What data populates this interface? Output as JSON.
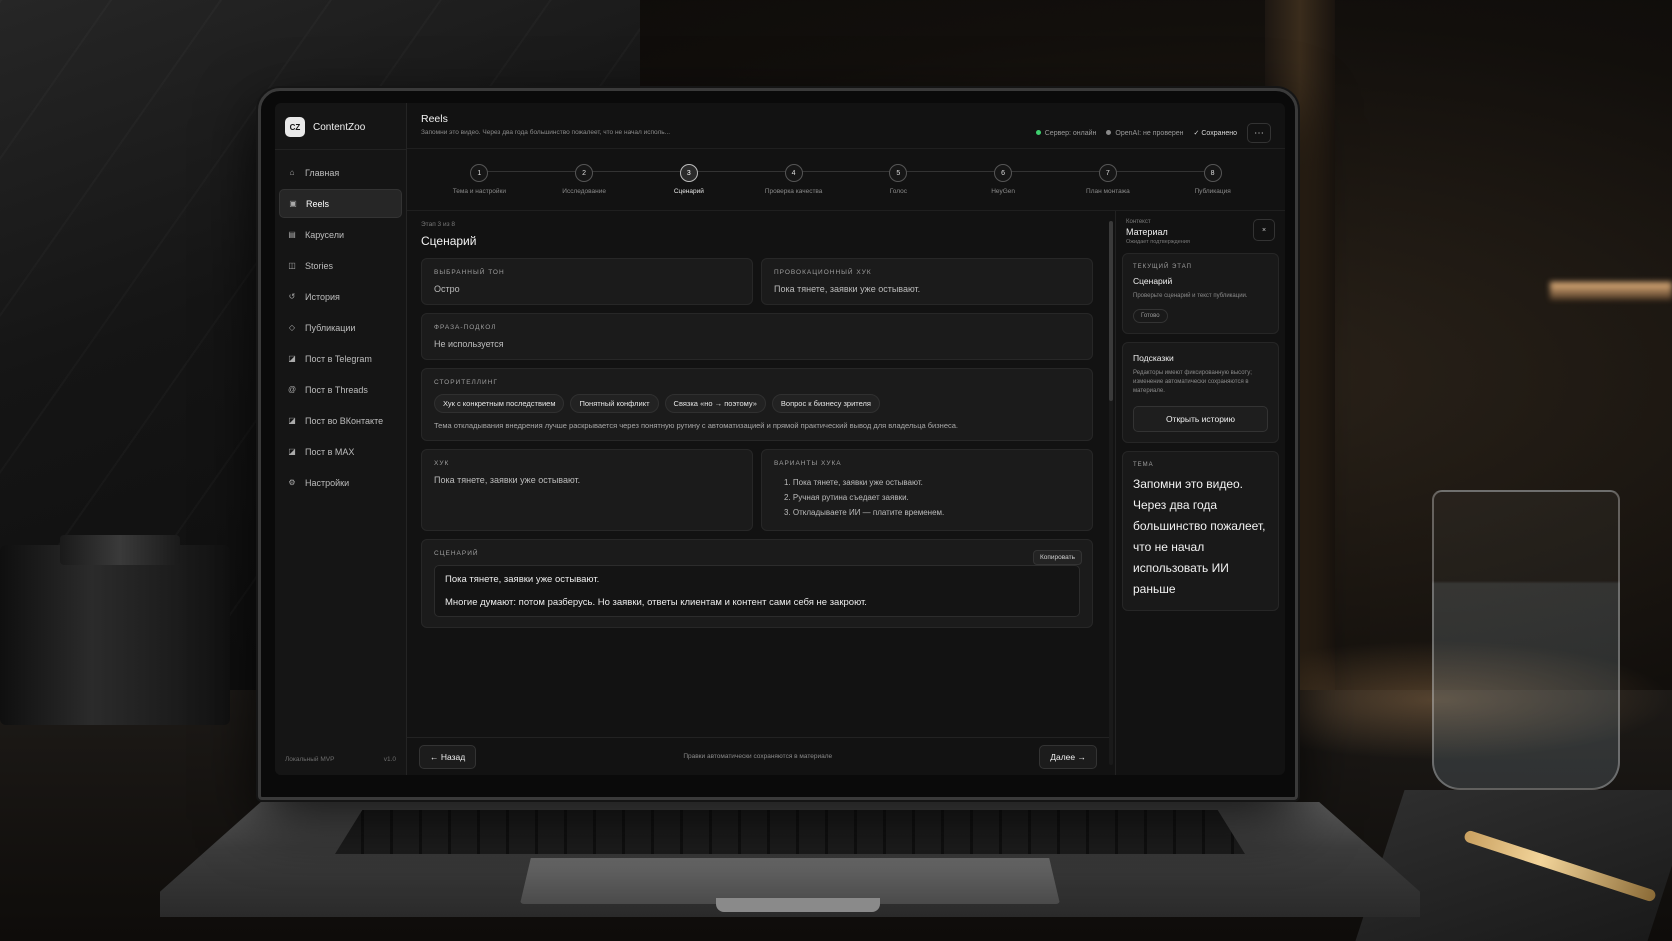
{
  "app": {
    "logo": "CZ",
    "name": "ContentZoo"
  },
  "sidebar": {
    "items": [
      {
        "icon": "home-icon",
        "label": "Главная",
        "active": false
      },
      {
        "icon": "reels-icon",
        "label": "Reels",
        "active": true
      },
      {
        "icon": "carousel-icon",
        "label": "Карусели",
        "active": false
      },
      {
        "icon": "stories-icon",
        "label": "Stories",
        "active": false
      },
      {
        "icon": "history-icon",
        "label": "История",
        "active": false
      },
      {
        "icon": "publish-icon",
        "label": "Публикации",
        "active": false
      },
      {
        "icon": "telegram-icon",
        "label": "Пост в Telegram",
        "active": false
      },
      {
        "icon": "threads-icon",
        "label": "Пост в Threads",
        "active": false
      },
      {
        "icon": "vk-icon",
        "label": "Пост во ВКонтакте",
        "active": false
      },
      {
        "icon": "max-icon",
        "label": "Пост в MAX",
        "active": false
      },
      {
        "icon": "settings-icon",
        "label": "Настройки",
        "active": false
      }
    ],
    "footer_left": "Локальный MVP",
    "footer_right": "v1.0"
  },
  "topbar": {
    "title": "Reels",
    "subtitle": "Запомни это видео. Через два года большинство пожалеет, что не начал исполь...",
    "server_status": "Сервер: онлайн",
    "openai_status": "OpenAI: не проверен",
    "saved_status": "✓ Сохранено",
    "more": "⋯"
  },
  "stepper": {
    "current": 3,
    "steps": [
      {
        "num": "1",
        "label": "Тема и настройки"
      },
      {
        "num": "2",
        "label": "Исследование"
      },
      {
        "num": "3",
        "label": "Сценарий"
      },
      {
        "num": "4",
        "label": "Проверка качества"
      },
      {
        "num": "5",
        "label": "Голос"
      },
      {
        "num": "6",
        "label": "HeyGen"
      },
      {
        "num": "7",
        "label": "План монтажа"
      },
      {
        "num": "8",
        "label": "Публикация"
      }
    ]
  },
  "stage": {
    "meta": "Этап 3 из 8",
    "title": "Сценарий"
  },
  "cards": {
    "tone_label": "Выбранный тон",
    "tone_value": "Остро",
    "provocative_label": "Провокационный хук",
    "provocative_value": "Пока тянете, заявки уже остывают.",
    "phrase_label": "Фраза-подкол",
    "phrase_value": "Не используется",
    "storytelling_label": "Сторителлинг",
    "storytelling_chips": [
      "Хук с конкретным последствием",
      "Понятный конфликт",
      "Связка «но → поэтому»",
      "Вопрос к бизнесу зрителя"
    ],
    "storytelling_text": "Тема откладывания внедрения лучше раскрывается через понятную рутину с автоматизацией и прямой практический вывод для владельца бизнеса.",
    "hook_label": "Хук",
    "hook_value": "Пока тянете, заявки уже остывают.",
    "hook_variants_label": "Варианты хука",
    "hook_variants": [
      "Пока тянете, заявки уже остывают.",
      "Ручная рутина съедает заявки.",
      "Откладываете ИИ — платите временем."
    ],
    "script_label": "Сценарий",
    "copy_label": "Копировать",
    "script_lines": [
      "Пока тянете, заявки уже остывают.",
      "Многие думают: потом разберусь. Но заявки, ответы клиентам и контент сами себя не закроют."
    ]
  },
  "footer": {
    "back": "← Назад",
    "note": "Правки автоматически сохраняются в материале",
    "next": "Далее →"
  },
  "right_panel": {
    "kicker": "Контекст",
    "title": "Материал",
    "sub": "Ожидает подтверждения",
    "close": "×",
    "current_stage_label": "Текущий этап",
    "current_stage_title": "Сценарий",
    "current_stage_text": "Проверьте сценарий и текст публикации.",
    "ready_badge": "Готово",
    "hints_title": "Подсказки",
    "hints_text": "Редакторы имеют фиксированную высоту; изменение автоматически сохраняются в материале.",
    "open_history": "Открыть историю",
    "theme_label": "Тема",
    "theme_text": "Запомни это видео. Через два года большинство пожалеет, что не начал использовать ИИ раньше"
  }
}
